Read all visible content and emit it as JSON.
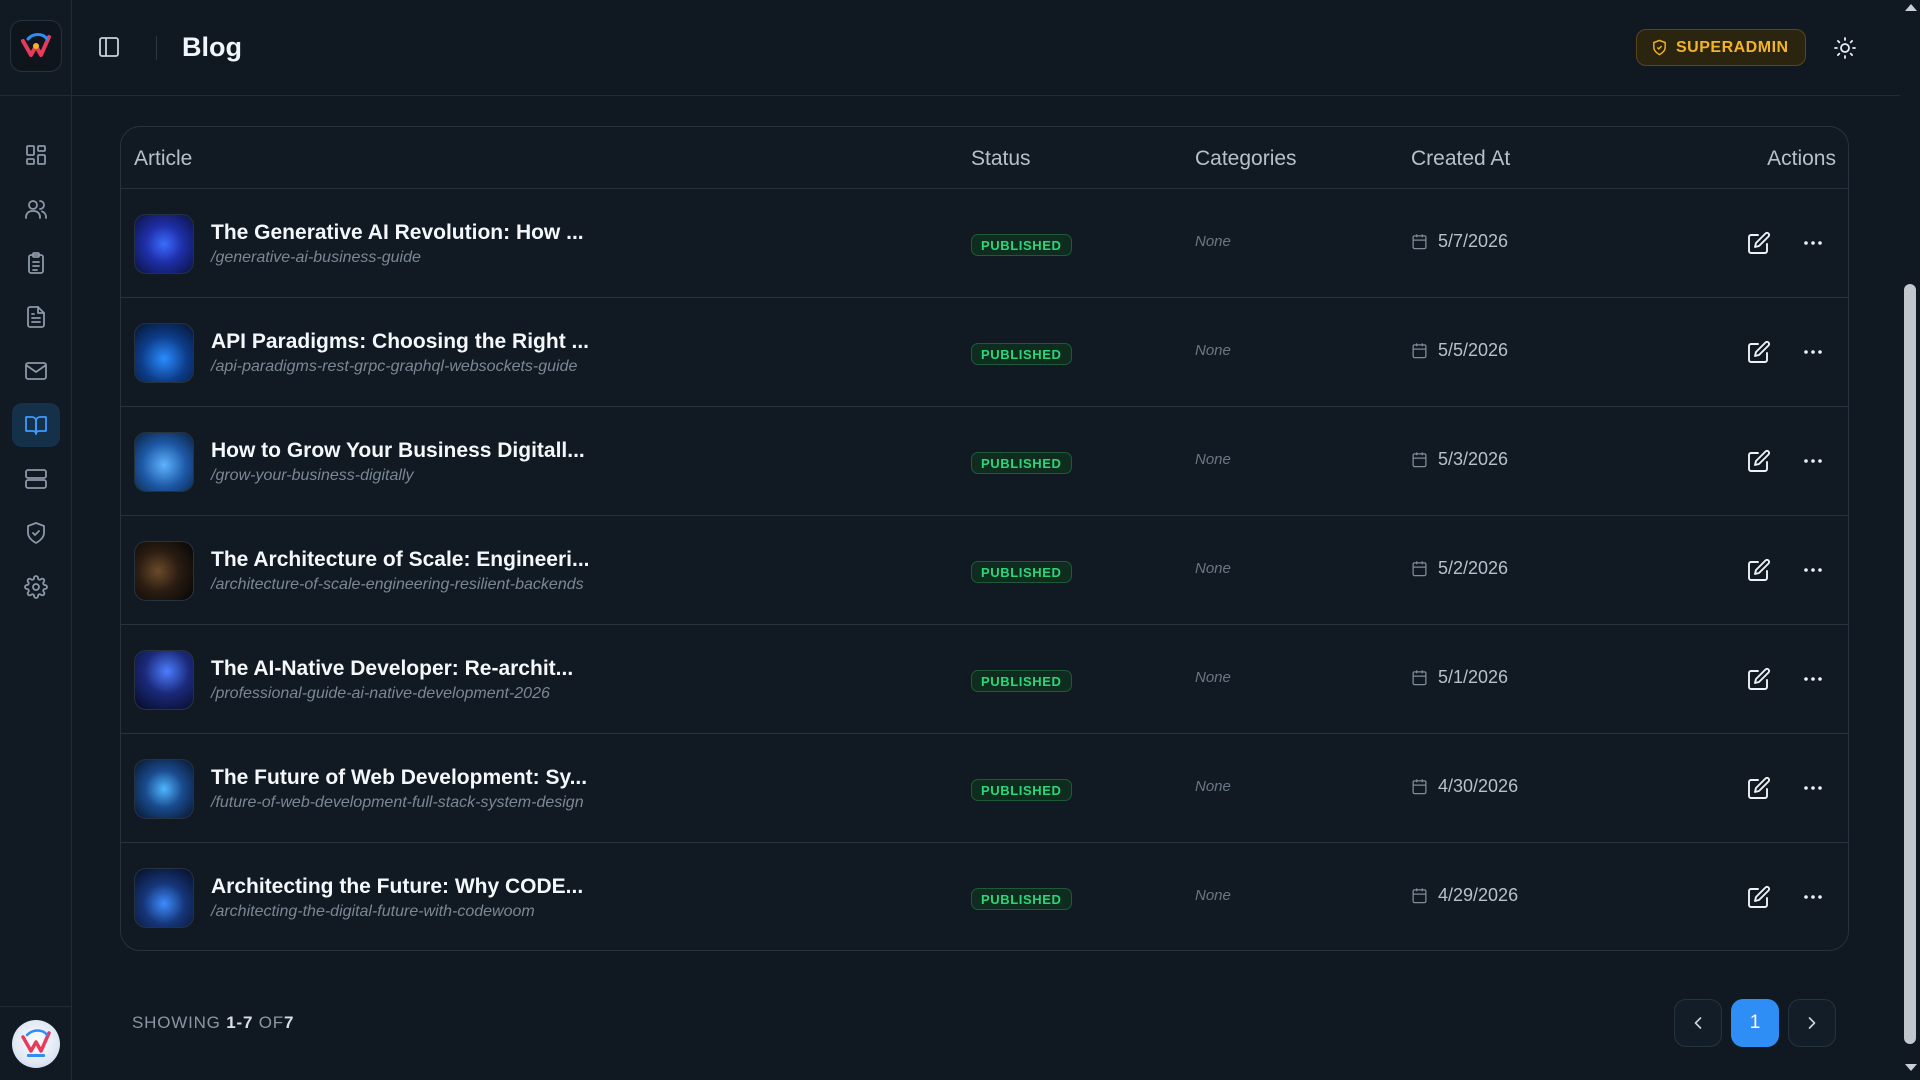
{
  "header": {
    "title": "Blog",
    "role_badge": "SUPERADMIN"
  },
  "sidebar": {
    "items": [
      {
        "icon": "dashboard-icon",
        "active": false
      },
      {
        "icon": "users-icon",
        "active": false
      },
      {
        "icon": "clipboard-icon",
        "active": false
      },
      {
        "icon": "document-icon",
        "active": false
      },
      {
        "icon": "mail-icon",
        "active": false
      },
      {
        "icon": "book-open-icon",
        "active": true
      },
      {
        "icon": "server-icon",
        "active": false
      },
      {
        "icon": "shield-check-icon",
        "active": false
      },
      {
        "icon": "settings-icon",
        "active": false
      }
    ]
  },
  "table": {
    "columns": {
      "article": "Article",
      "status": "Status",
      "categories": "Categories",
      "created_at": "Created At",
      "actions": "Actions"
    },
    "rows": [
      {
        "title": "The Generative AI Revolution: How ...",
        "slug": "/generative-ai-business-guide",
        "status": "PUBLISHED",
        "categories": "None",
        "created": "5/7/2026"
      },
      {
        "title": "API Paradigms: Choosing the Right ...",
        "slug": "/api-paradigms-rest-grpc-graphql-websockets-guide",
        "status": "PUBLISHED",
        "categories": "None",
        "created": "5/5/2026"
      },
      {
        "title": "How to Grow Your Business Digitall...",
        "slug": "/grow-your-business-digitally",
        "status": "PUBLISHED",
        "categories": "None",
        "created": "5/3/2026"
      },
      {
        "title": "The Architecture of Scale: Engineeri...",
        "slug": "/architecture-of-scale-engineering-resilient-backends",
        "status": "PUBLISHED",
        "categories": "None",
        "created": "5/2/2026"
      },
      {
        "title": "The AI-Native Developer: Re-archit...",
        "slug": "/professional-guide-ai-native-development-2026",
        "status": "PUBLISHED",
        "categories": "None",
        "created": "5/1/2026"
      },
      {
        "title": "The Future of Web Development: Sy...",
        "slug": "/future-of-web-development-full-stack-system-design",
        "status": "PUBLISHED",
        "categories": "None",
        "created": "4/30/2026"
      },
      {
        "title": "Architecting the Future: Why CODE...",
        "slug": "/architecting-the-digital-future-with-codewoom",
        "status": "PUBLISHED",
        "categories": "None",
        "created": "4/29/2026"
      }
    ]
  },
  "footer": {
    "showing_prefix": "SHOWING ",
    "range_start": "1",
    "dash": "-",
    "range_end": "7",
    "of_label": " OF",
    "total": "7",
    "current_page": "1"
  },
  "colors": {
    "accent": "#2f8ef5",
    "status_published": "#2bd679",
    "role_badge": "#f3b428",
    "background": "#101821"
  }
}
